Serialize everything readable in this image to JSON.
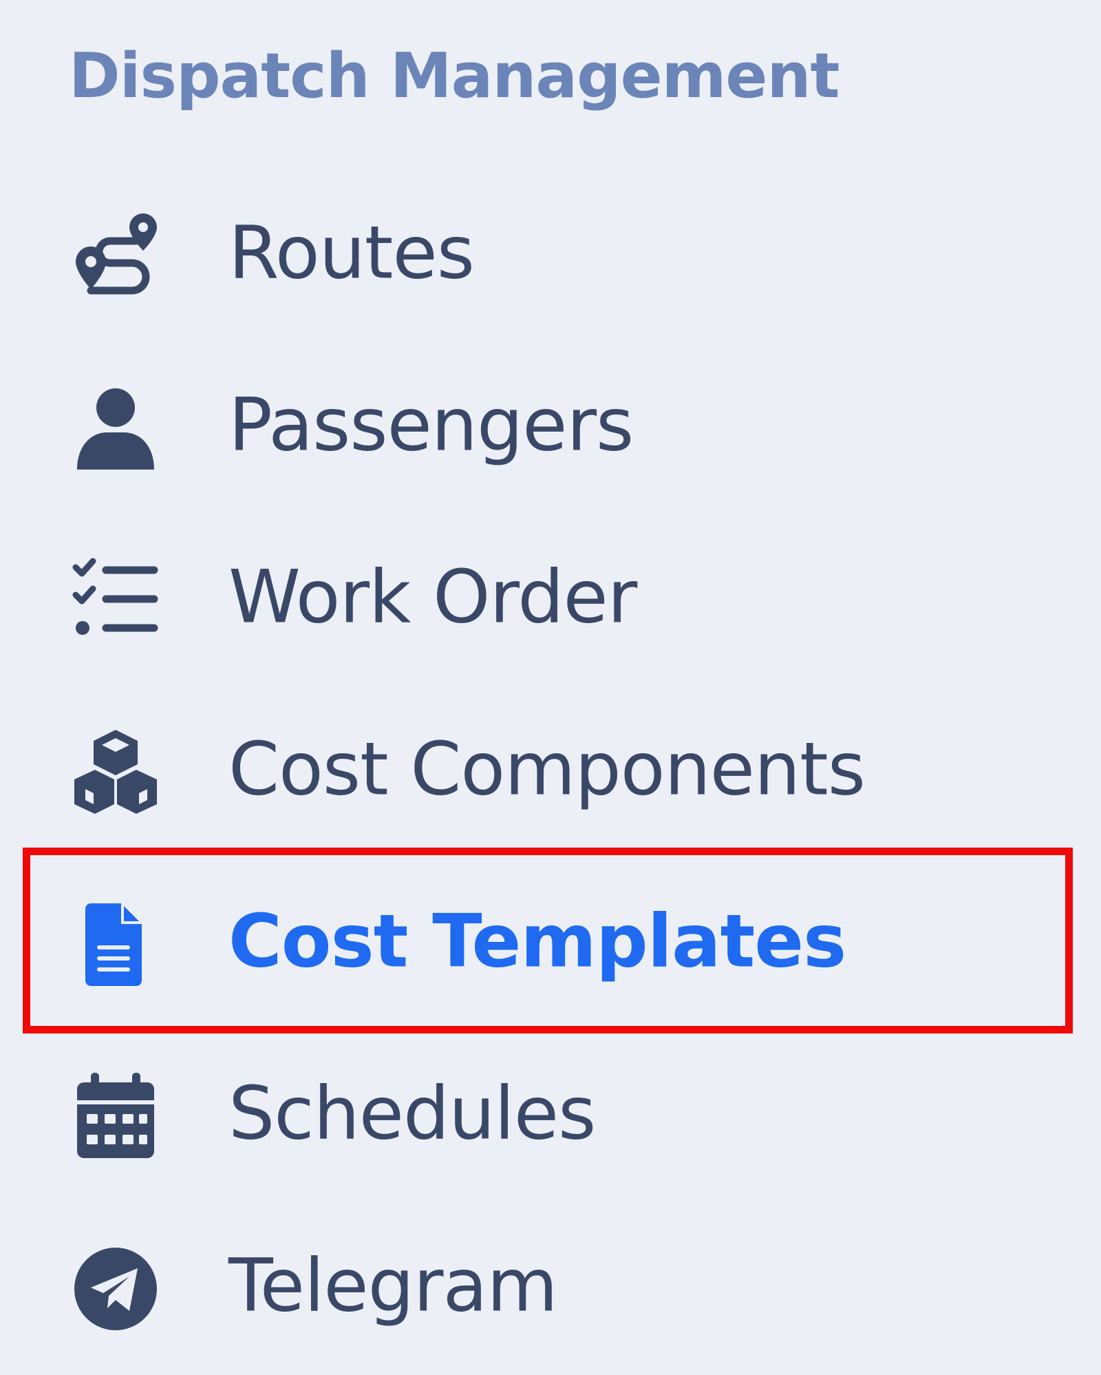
{
  "section": {
    "title": "Dispatch Management"
  },
  "colors": {
    "background": "#eceff6",
    "section_title": "#6b85b8",
    "item_text": "#3a4868",
    "active_text": "#1f6af0",
    "highlight_border": "#ee0a0a"
  },
  "menu": {
    "items": [
      {
        "label": "Routes",
        "icon": "route-icon",
        "active": false
      },
      {
        "label": "Passengers",
        "icon": "user-icon",
        "active": false
      },
      {
        "label": "Work Order",
        "icon": "checklist-icon",
        "active": false
      },
      {
        "label": "Cost Components",
        "icon": "cubes-icon",
        "active": false
      },
      {
        "label": "Cost Templates",
        "icon": "file-document-icon",
        "active": true
      },
      {
        "label": "Schedules",
        "icon": "calendar-icon",
        "active": false
      },
      {
        "label": "Telegram",
        "icon": "telegram-icon",
        "active": false
      }
    ]
  }
}
